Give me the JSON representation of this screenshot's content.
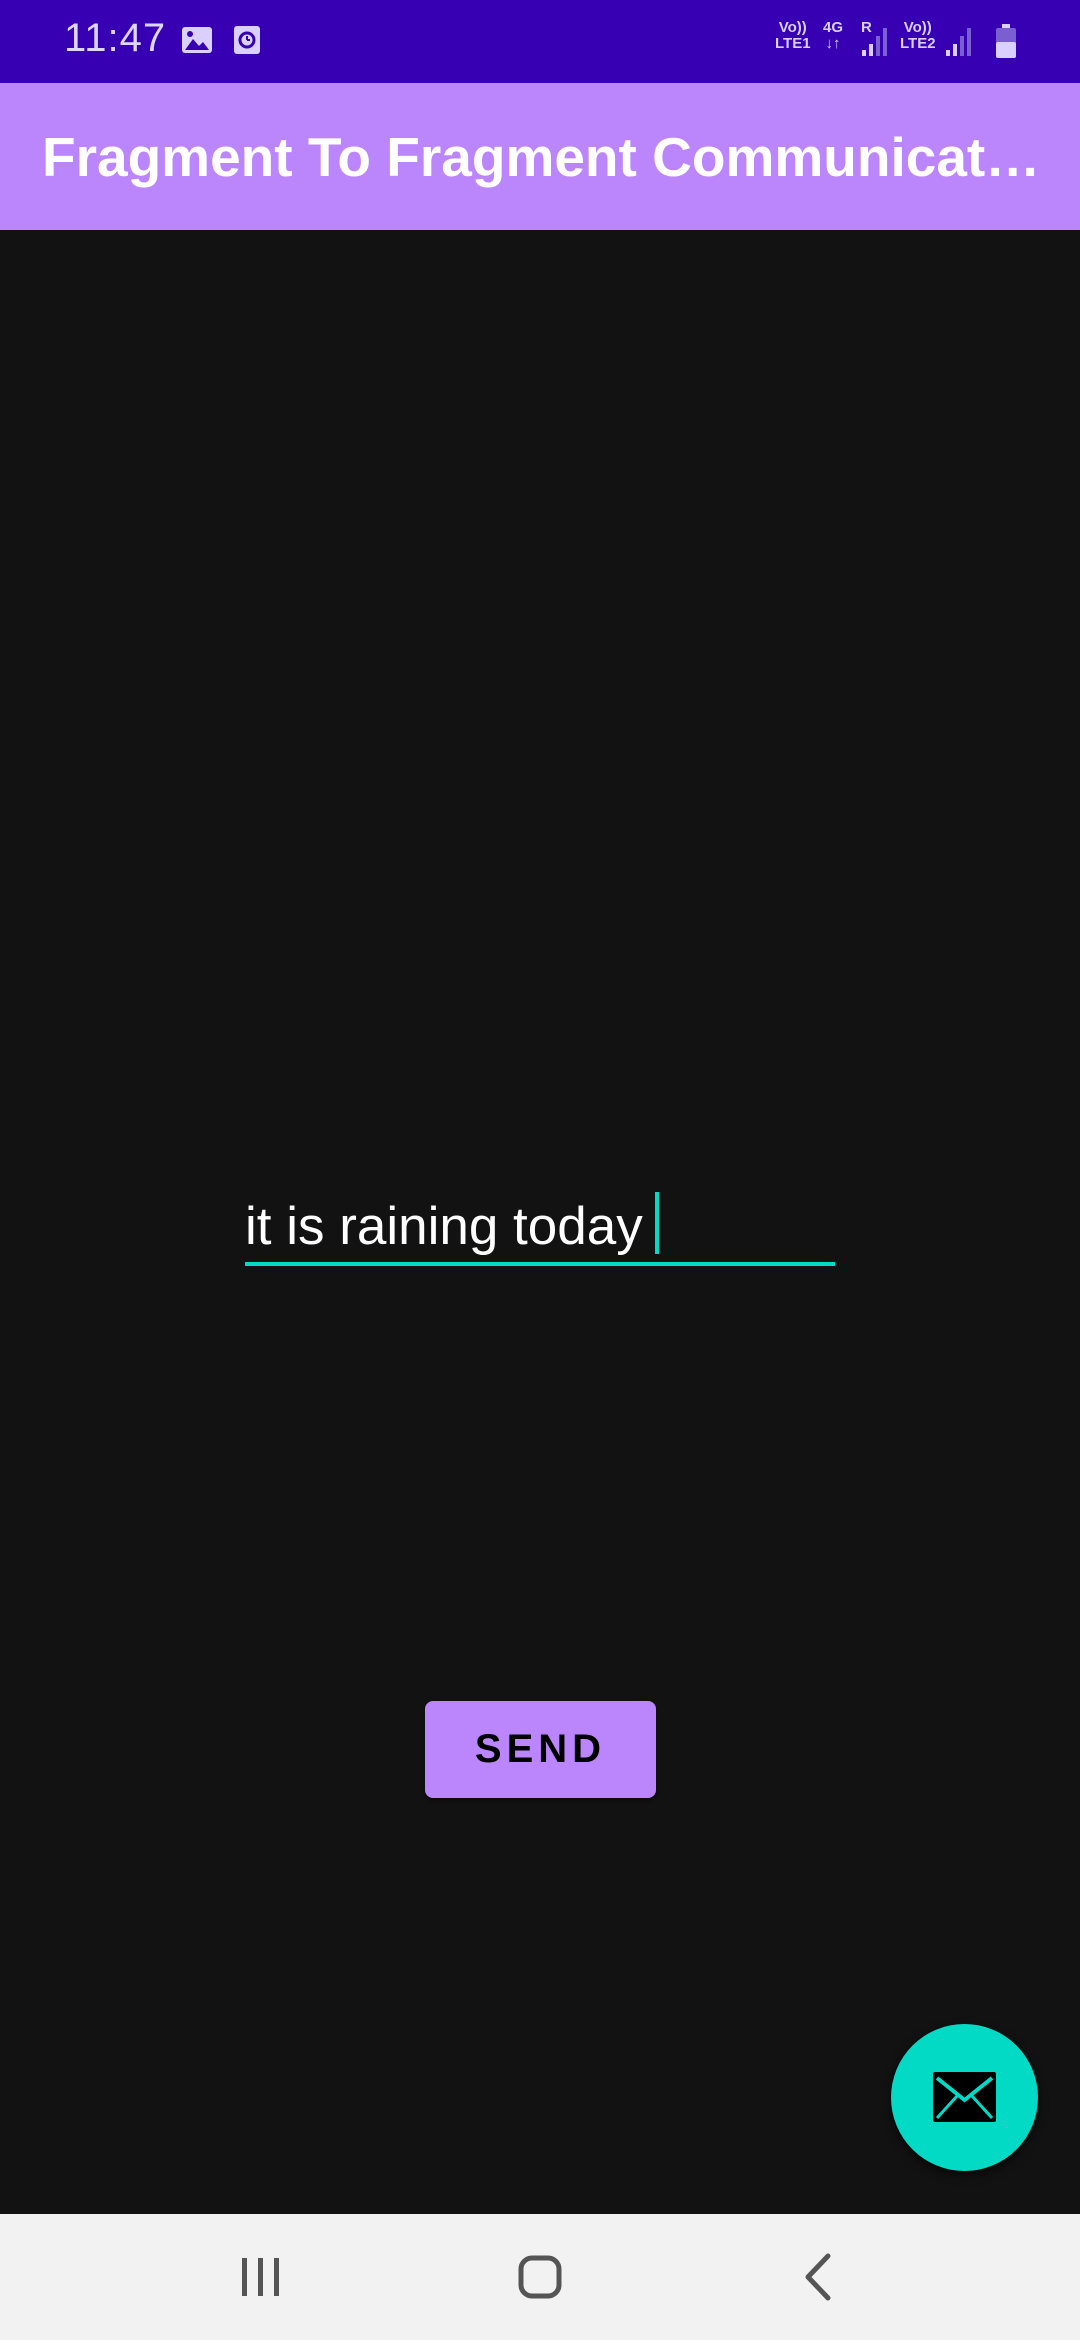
{
  "status_bar": {
    "time": "11:47",
    "icons": [
      "image-icon",
      "clock-icon"
    ],
    "sim1": {
      "top": "Vo))",
      "bottom": "LTE1"
    },
    "network_type": "4G",
    "roaming": "R",
    "sim2": {
      "top": "Vo))",
      "bottom": "LTE2"
    },
    "battery_icon": "battery-icon",
    "background_color": "#3700b3"
  },
  "app_bar": {
    "title": "Fragment To Fragment Communication",
    "background_color": "#bb86fc"
  },
  "message_input": {
    "value": "it is raining today",
    "accent_color": "#03dac5"
  },
  "send_button": {
    "label": "SEND"
  },
  "fab": {
    "icon": "mail-icon",
    "color": "#03dac5"
  },
  "nav_bar": {
    "buttons": [
      "recent-apps-icon",
      "home-icon",
      "back-icon"
    ]
  }
}
